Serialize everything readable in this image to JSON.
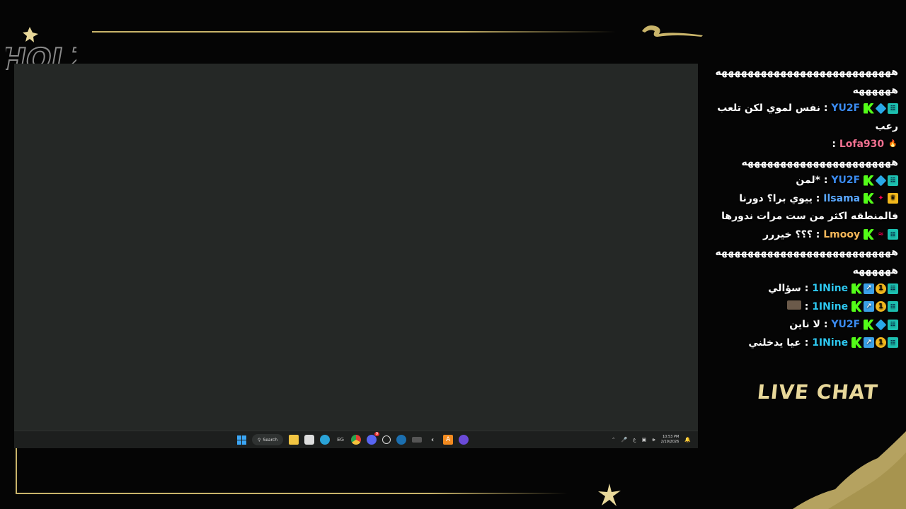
{
  "overlay": {
    "logo_text": "HOLZ",
    "live_chat_label": "LIVE CHAT",
    "accent_color": "#c9b46a"
  },
  "taskbar": {
    "search_label": "Search",
    "time": "10:53 PM",
    "date": "2/19/2026",
    "lang": "ع",
    "notification_badge": "9"
  },
  "chat": {
    "messages": [
      {
        "user": "",
        "user_color": "#ffffff",
        "badges": [],
        "text": "هههههههههههههههههههههههههههه ههههههه"
      },
      {
        "user": "YU2F",
        "user_color": "#3b8bf0",
        "badges": [
          "kick",
          "cube",
          "sub"
        ],
        "text": "نفس لموي لكن تلعب رعب"
      },
      {
        "user": "Lofa930",
        "user_color": "#f07090",
        "badges": [
          "fire"
        ],
        "text": "هههههههههههههههههههههههه"
      },
      {
        "user": "YU2F",
        "user_color": "#3b8bf0",
        "badges": [
          "kick",
          "cube",
          "sub"
        ],
        "text": "*لمن"
      },
      {
        "user": "Ilsama",
        "user_color": "#5aa8ff",
        "badges": [
          "kick",
          "sparkle",
          "crown"
        ],
        "text": "ييوي برا؟ دورنا فالمنطقه اكثر من ست مرات ندورها"
      },
      {
        "user": "Lmooy",
        "user_color": "#f6b85a",
        "badges": [
          "kick",
          "wave",
          "sub"
        ],
        "text": "؟؟؟ خيررر"
      },
      {
        "user": "",
        "user_color": "#ffffff",
        "badges": [],
        "text": "هههههههههههههههههههههههههههه ههههههه"
      },
      {
        "user": "1INine",
        "user_color": "#2ec8f0",
        "badges": [
          "kick",
          "arrow",
          "one",
          "sub"
        ],
        "text": "سؤالي"
      },
      {
        "user": "1INine",
        "user_color": "#2ec8f0",
        "badges": [
          "kick",
          "arrow",
          "one",
          "sub"
        ],
        "text": ""
      },
      {
        "user": "YU2F",
        "user_color": "#3b8bf0",
        "badges": [
          "kick",
          "cube",
          "sub"
        ],
        "text": "لا ناين"
      },
      {
        "user": "1INine",
        "user_color": "#2ec8f0",
        "badges": [
          "kick",
          "arrow",
          "one",
          "sub"
        ],
        "text": "عيا يدخلني"
      }
    ]
  }
}
